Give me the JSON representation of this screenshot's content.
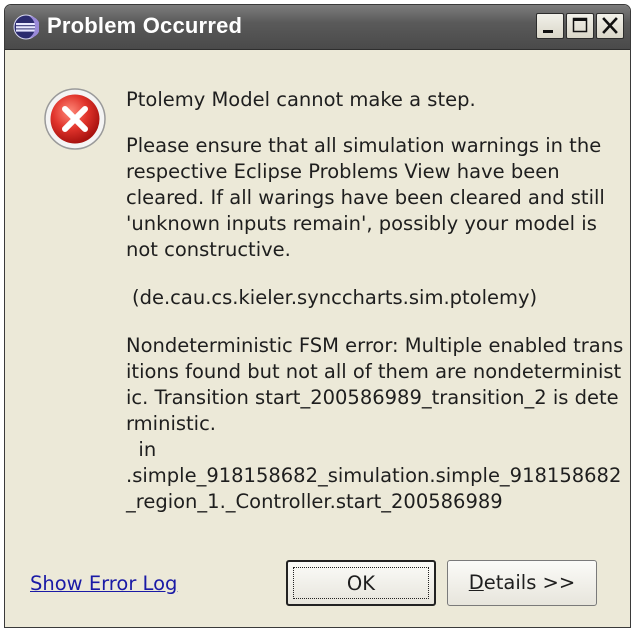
{
  "window": {
    "title": "Problem Occurred"
  },
  "message": {
    "heading": "Ptolemy Model cannot make a step.",
    "body": "Please ensure that all simulation warnings in the respective Eclipse Problems View have been cleared. If all warings have been cleared and still 'unknown  inputs remain', possibly your model is not constructive.",
    "plugin": "(de.cau.cs.kieler.synccharts.sim.ptolemy)",
    "detail": "Nondeterministic FSM error: Multiple enabled transitions found but not all of them are nondeterministic. Transition start_200586989_transition_2 is deterministic.\n  in\n.simple_918158682_simulation.simple_918158682_region_1._Controller.start_200586989"
  },
  "links": {
    "show_error_log": "Show Error Log"
  },
  "buttons": {
    "ok": "OK",
    "details_mnemonic": "D",
    "details_rest": "etails >>"
  },
  "icons": {
    "title": "eclipse-icon",
    "error": "error-icon",
    "minimize": "minimize-icon",
    "maximize": "maximize-icon",
    "close": "close-icon"
  },
  "colors": {
    "titlebar": "#5a5a5a",
    "dialog_bg": "#ece9d8",
    "error_red": "#d42a2a",
    "link": "#1a1aa6"
  }
}
